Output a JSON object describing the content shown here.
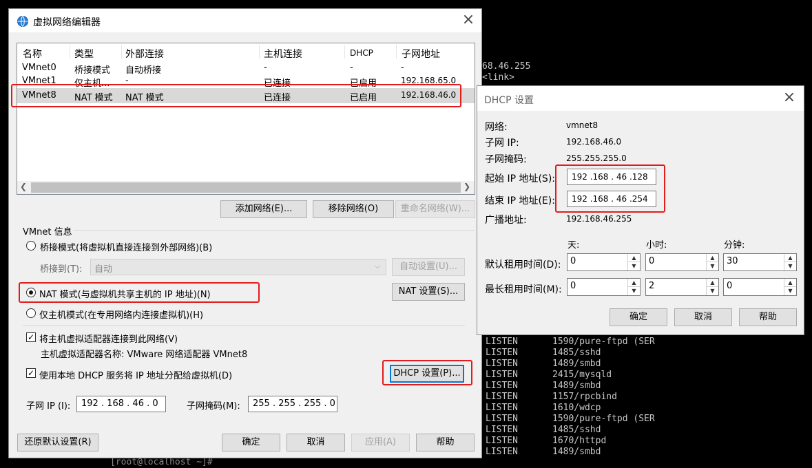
{
  "terminal": {
    "lines_top": [
      "68.46.255",
      "<link>"
    ],
    "rows": [
      {
        "state": "LISTEN",
        "proc": "1590/pure-ftpd (SER"
      },
      {
        "state": "LISTEN",
        "proc": "1485/sshd"
      },
      {
        "state": "LISTEN",
        "proc": "1489/smbd"
      },
      {
        "state": "LISTEN",
        "proc": "2415/mysqld"
      },
      {
        "state": "LISTEN",
        "proc": "1489/smbd"
      },
      {
        "state": "LISTEN",
        "proc": "1157/rpcbind"
      },
      {
        "state": "LISTEN",
        "proc": "1610/wdcp"
      },
      {
        "state": "LISTEN",
        "proc": "1590/pure-ftpd (SER"
      },
      {
        "state": "LISTEN",
        "proc": "1485/sshd"
      },
      {
        "state": "LISTEN",
        "proc": "1670/httpd"
      },
      {
        "state": "LISTEN",
        "proc": "1489/smbd"
      }
    ],
    "bottom": "[root@localhost ~]#"
  },
  "vne": {
    "title": "虚拟网络编辑器",
    "headers": [
      "名称",
      "类型",
      "外部连接",
      "主机连接",
      "DHCP",
      "子网地址"
    ],
    "rows": [
      [
        "VMnet0",
        "桥接模式",
        "自动桥接",
        "-",
        "-",
        "-"
      ],
      [
        "VMnet1",
        "仅主机...",
        "-",
        "已连接",
        "已启用",
        "192.168.65.0"
      ],
      [
        "VMnet8",
        "NAT 模式",
        "NAT 模式",
        "已连接",
        "已启用",
        "192.168.46.0"
      ]
    ],
    "add_network": "添加网络(E)...",
    "remove_network": "移除网络(O)",
    "rename_network": "重命名网络(W)...",
    "info_group": "VMnet 信息",
    "bridge_mode": "桥接模式(将虚拟机直接连接到外部网络)(B)",
    "bridge_to_label": "桥接到(T):",
    "bridge_to_value": "自动",
    "auto_settings": "自动设置(U)...",
    "nat_mode": "NAT 模式(与虚拟机共享主机的 IP 地址)(N)",
    "nat_settings": "NAT 设置(S)...",
    "host_only": "仅主机模式(在专用网络内连接虚拟机)(H)",
    "connect_adapter": "将主机虚拟适配器连接到此网络(V)",
    "adapter_name": "主机虚拟适配器名称: VMware 网络适配器 VMnet8",
    "use_dhcp": "使用本地 DHCP 服务将 IP 地址分配给虚拟机(D)",
    "dhcp_settings": "DHCP 设置(P)...",
    "subnet_ip_label": "子网 IP (I):",
    "subnet_ip_value": "192 . 168 . 46  .  0",
    "subnet_mask_label": "子网掩码(M):",
    "subnet_mask_value": "255 . 255 . 255 .  0",
    "restore_defaults": "还原默认设置(R)",
    "ok": "确定",
    "cancel": "取消",
    "apply": "应用(A)",
    "help": "帮助"
  },
  "dhcp": {
    "title": "DHCP 设置",
    "network_label": "网络:",
    "network_value": "vmnet8",
    "subnet_ip_label": "子网 IP:",
    "subnet_ip_value": "192.168.46.0",
    "subnet_mask_label": "子网掩码:",
    "subnet_mask_value": "255.255.255.0",
    "start_ip_label": "起始 IP 地址(S):",
    "start_ip_value": "192 .168 . 46  .128",
    "end_ip_label": "结束 IP 地址(E):",
    "end_ip_value": "192 .168 . 46  .254",
    "broadcast_label": "广播地址:",
    "broadcast_value": "192.168.46.255",
    "col_days": "天:",
    "col_hours": "小时:",
    "col_minutes": "分钟:",
    "default_lease_label": "默认租用时间(D):",
    "default_days": "0",
    "default_hours": "0",
    "default_minutes": "30",
    "max_lease_label": "最长租用时间(M):",
    "max_days": "0",
    "max_hours": "2",
    "max_minutes": "0",
    "ok": "确定",
    "cancel": "取消",
    "help": "帮助"
  }
}
